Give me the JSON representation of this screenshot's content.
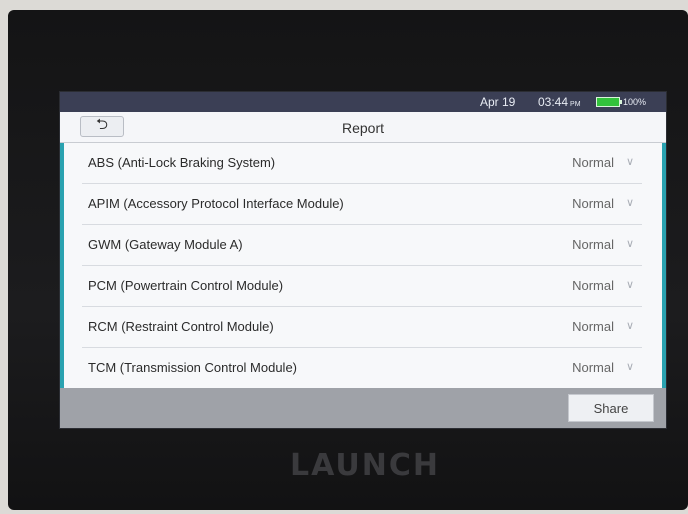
{
  "device": {
    "brand": "LAUNCH"
  },
  "status_bar": {
    "date": "Apr 19",
    "time": "03:44",
    "ampm": "PM",
    "battery": "100%",
    "battery_level": 1.0,
    "battery_color": "#33c23c"
  },
  "header": {
    "back_icon": "back-arrow-icon",
    "title": "Report"
  },
  "modules": [
    {
      "label": "ABS (Anti-Lock Braking System)",
      "status": "Normal"
    },
    {
      "label": "APIM (Accessory Protocol Interface Module)",
      "status": "Normal"
    },
    {
      "label": "GWM (Gateway Module A)",
      "status": "Normal"
    },
    {
      "label": "PCM (Powertrain Control Module)",
      "status": "Normal"
    },
    {
      "label": "RCM (Restraint Control Module)",
      "status": "Normal"
    },
    {
      "label": "TCM (Transmission Control Module)",
      "status": "Normal"
    }
  ],
  "footer": {
    "share_label": "Share"
  },
  "colors": {
    "accent": "#2aa2b0",
    "statusbar": "#3b3f55"
  }
}
